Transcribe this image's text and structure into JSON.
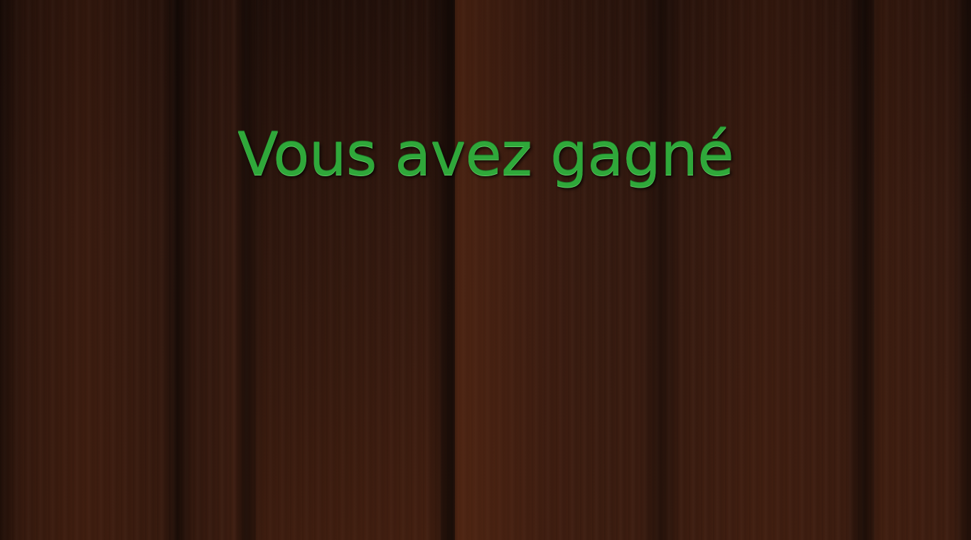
{
  "screen": {
    "message": "Vous avez gagné"
  },
  "colors": {
    "message_text": "#2fa83a",
    "background_wood": "#3a1c10"
  }
}
